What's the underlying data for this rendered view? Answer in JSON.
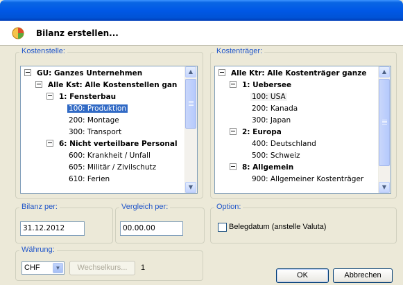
{
  "dialog": {
    "title": "Bilanz erstellen...",
    "icon": "report-icon"
  },
  "kostenstelle": {
    "label": "Kostenstelle:",
    "items": [
      {
        "text": "GU: Ganzes Unternehmen",
        "bold": true,
        "expander": true
      },
      {
        "text": "Alle Kst: Alle Kostenstellen gan",
        "bold": true,
        "expander": true
      },
      {
        "text": "1: Fensterbau",
        "bold": true,
        "expander": true
      },
      {
        "text": "100: Produktion",
        "bold": false,
        "expander": false,
        "selected": true
      },
      {
        "text": "200: Montage",
        "bold": false,
        "expander": false
      },
      {
        "text": "300: Transport",
        "bold": false,
        "expander": false
      },
      {
        "text": "6: Nicht verteilbare Personal",
        "bold": true,
        "expander": true
      },
      {
        "text": "600: Krankheit / Unfall",
        "bold": false,
        "expander": false
      },
      {
        "text": "605: Militär / Zivilschutz",
        "bold": false,
        "expander": false
      },
      {
        "text": "610: Ferien",
        "bold": false,
        "expander": false
      }
    ]
  },
  "kostentraeger": {
    "label": "Kostenträger:",
    "items": [
      {
        "text": "Alle Ktr: Alle Kostenträger ganze",
        "bold": true,
        "expander": true
      },
      {
        "text": "1: Uebersee",
        "bold": true,
        "expander": true
      },
      {
        "text": "100: USA",
        "bold": false,
        "expander": false,
        "highlighted": true
      },
      {
        "text": "200: Kanada",
        "bold": false,
        "expander": false
      },
      {
        "text": "300: Japan",
        "bold": false,
        "expander": false
      },
      {
        "text": "2: Europa",
        "bold": true,
        "expander": true
      },
      {
        "text": "400: Deutschland",
        "bold": false,
        "expander": false
      },
      {
        "text": "500: Schweiz",
        "bold": false,
        "expander": false
      },
      {
        "text": "8: Allgemein",
        "bold": true,
        "expander": true
      },
      {
        "text": "900: Allgemeiner Kostenträger",
        "bold": false,
        "expander": false
      }
    ]
  },
  "bilanz_per": {
    "label": "Bilanz per:",
    "value": "31.12.2012"
  },
  "vergleich_per": {
    "label": "Vergleich per:",
    "value": "00.00.00"
  },
  "option": {
    "label": "Option:",
    "checkbox_label": "Belegdatum (anstelle Valuta)",
    "checked": false
  },
  "waehrung": {
    "label": "Währung:",
    "selected": "CHF",
    "wechselkurs_label": "Wechselkurs...",
    "rate": "1"
  },
  "buttons": {
    "ok": "OK",
    "cancel": "Abbrechen"
  },
  "colors": {
    "accent": "#2156C9",
    "selection": "#316AC5",
    "titlebar": "#0058E6",
    "background": "#ECE9D8"
  }
}
